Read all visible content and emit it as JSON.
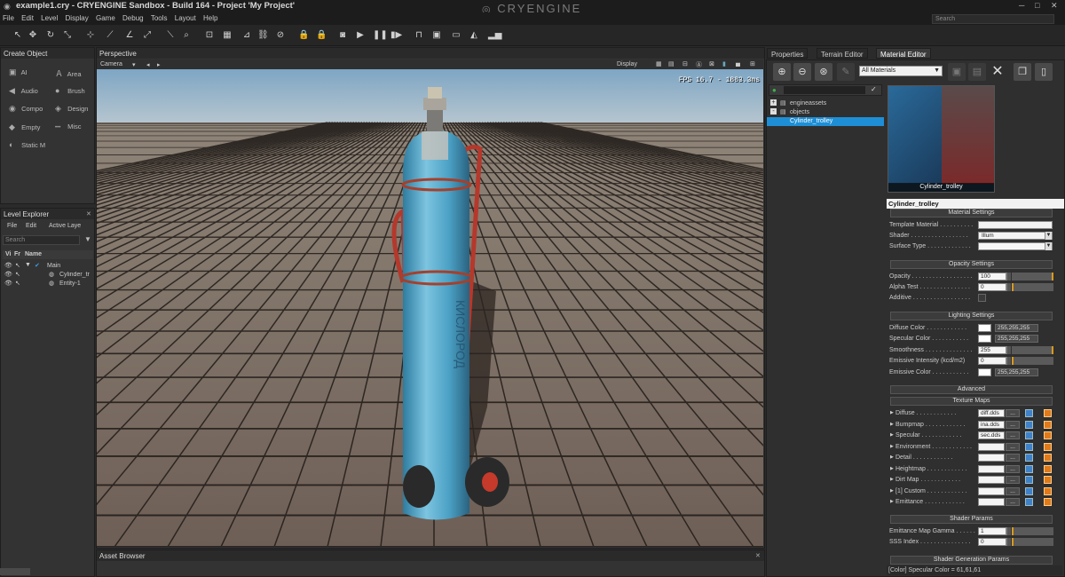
{
  "window": {
    "title": "example1.cry - CRYENGINE Sandbox - Build 164 - Project 'My Project'",
    "logo": "CRYENGINE",
    "search_placeholder": "Search",
    "minimize": "─",
    "maximize": "□",
    "close": "✕"
  },
  "menu": [
    "File",
    "Edit",
    "Level",
    "Display",
    "Game",
    "Debug",
    "Tools",
    "Layout",
    "Help"
  ],
  "create_object": {
    "title": "Create Object",
    "items": [
      {
        "label": "AI",
        "icon": "ai-icon",
        "glyph": "▣"
      },
      {
        "label": "Area",
        "icon": "area-icon",
        "glyph": "Ａ"
      },
      {
        "label": "Audio",
        "icon": "audio-icon",
        "glyph": "◀"
      },
      {
        "label": "Brush",
        "icon": "brush-icon",
        "glyph": "●"
      },
      {
        "label": "Compo",
        "icon": "component-icon",
        "glyph": "◉"
      },
      {
        "label": "Design",
        "icon": "designer-icon",
        "glyph": "◈"
      },
      {
        "label": "Empty",
        "icon": "empty-icon",
        "glyph": "◆"
      },
      {
        "label": "Misc",
        "icon": "misc-icon",
        "glyph": "•••"
      },
      {
        "label": "Static M",
        "icon": "static-mesh-icon",
        "glyph": "◐"
      }
    ]
  },
  "level_explorer": {
    "title": "Level Explorer",
    "menu": [
      "File",
      "Edit",
      "Active Laye"
    ],
    "search_placeholder": "Search",
    "columns": [
      "Vi",
      "Fr",
      "Name"
    ],
    "rows": [
      {
        "name": "Main",
        "indent": 0
      },
      {
        "name": "Cylinder_tr",
        "indent": 1
      },
      {
        "name": "Entity-1",
        "indent": 1
      }
    ]
  },
  "viewport": {
    "tab": "Perspective",
    "camera_menu": "Camera",
    "display_menu": "Display",
    "fps": "FPS 16.7 - 1883.3ms",
    "cylinder_text": "КИСЛОРОД"
  },
  "asset_browser": {
    "title": "Asset Browser"
  },
  "right_tabs": [
    "Properties",
    "Terrain Editor",
    "Material Editor"
  ],
  "material_editor": {
    "filter": "All Materials",
    "tree": [
      {
        "label": "engineassets",
        "toggle": "+"
      },
      {
        "label": "objects",
        "toggle": "-"
      },
      {
        "label": "Cylinder_trolley",
        "toggle": ""
      }
    ],
    "preview_caption": "Cylinder_trolley",
    "material_name": "Cylinder_trolley",
    "sections": {
      "material_settings": "Material Settings",
      "opacity_settings": "Opacity Settings",
      "lighting_settings": "Lighting Settings",
      "advanced": "Advanced",
      "texture_maps": "Texture Maps",
      "shader_params": "Shader Params",
      "shader_generation_params": "Shader Generation Params"
    },
    "material_settings": {
      "template_material": {
        "label": "Template Material",
        "value": ""
      },
      "shader": {
        "label": "Shader",
        "value": "Illum"
      },
      "surface_type": {
        "label": "Surface Type",
        "value": ""
      }
    },
    "opacity": {
      "opacity": {
        "label": "Opacity",
        "value": "100"
      },
      "alpha_test": {
        "label": "Alpha Test",
        "value": "0"
      },
      "additive": {
        "label": "Additive"
      }
    },
    "lighting": {
      "diffuse": {
        "label": "Diffuse Color",
        "value": "255,255,255"
      },
      "specular": {
        "label": "Specular Color",
        "value": "255,255,255"
      },
      "smoothness": {
        "label": "Smoothness",
        "value": "255"
      },
      "emissive_intensity": {
        "label": "Emissive Intensity (kcd/m2)",
        "value": "0"
      },
      "emissive_color": {
        "label": "Emissive Color",
        "value": "255,255,255"
      }
    },
    "texture_maps": [
      {
        "label": "Diffuse",
        "value": "diff.dds"
      },
      {
        "label": "Bumpmap",
        "value": "ina.dds"
      },
      {
        "label": "Specular",
        "value": "sec.dds"
      },
      {
        "label": "Environment",
        "value": ""
      },
      {
        "label": "Detail",
        "value": ""
      },
      {
        "label": "Heightmap",
        "value": ""
      },
      {
        "label": "Dirt Map",
        "value": ""
      },
      {
        "label": "[1] Custom",
        "value": ""
      },
      {
        "label": "Emittance",
        "value": ""
      }
    ],
    "browse": "...",
    "shader_params": {
      "gamma": {
        "label": "Emittance Map Gamma",
        "value": "1"
      },
      "sss": {
        "label": "SSS Index",
        "value": "0"
      }
    },
    "status": "[Color] Specular Color = 61,61,61"
  },
  "colors": {
    "accent": "#1e8fd6",
    "highlight": "#d89a20",
    "sky": "#8fb0c8"
  }
}
